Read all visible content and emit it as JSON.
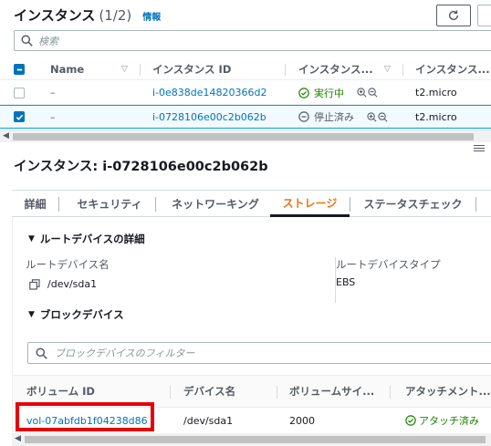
{
  "header": {
    "title": "インスタンス",
    "count": "(1/2)",
    "info_link": "情報"
  },
  "search": {
    "placeholder": "検索",
    "icon": "search-icon"
  },
  "table": {
    "columns": [
      "Name",
      "インスタンス ID",
      "インスタンス...",
      "インスタンス..."
    ],
    "rows": [
      {
        "selected": false,
        "name": "–",
        "instance_id": "i-0e838de14820366d2",
        "state": "実行中",
        "state_icon": "check-circle-icon",
        "type": "t2.micro"
      },
      {
        "selected": true,
        "name": "–",
        "instance_id": "i-0728106e00c2b062b",
        "state": "停止済み",
        "state_icon": "minus-circle-icon",
        "type": "t2.micro"
      }
    ]
  },
  "detail": {
    "title": "インスタンス: i-0728106e00c2b062b",
    "tabs": [
      "詳細",
      "セキュリティ",
      "ネットワーキング",
      "ストレージ",
      "ステータスチェック"
    ],
    "active_tab": "ストレージ",
    "root_section": {
      "heading": "ルートデバイスの詳細",
      "root_device_name_label": "ルートデバイス名",
      "root_device_name": "/dev/sda1",
      "root_device_type_label": "ルートデバイスタイプ",
      "root_device_type": "EBS"
    },
    "block_section": {
      "heading": "ブロックデバイス",
      "filter_placeholder": "ブロックデバイスのフィルター",
      "columns": [
        "ボリューム ID",
        "デバイス名",
        "ボリュームサイ...",
        "アタッチメント..."
      ],
      "rows": [
        {
          "volume_id": "vol-07abfdb1f04238d86",
          "device_name": "/dev/sda1",
          "size": "2000",
          "attachment": "アタッチ済み"
        }
      ]
    }
  },
  "colors": {
    "link": "#0073bb",
    "running": "#1d8102",
    "active_tab": "#ec7211",
    "highlight": "#e6000c"
  }
}
